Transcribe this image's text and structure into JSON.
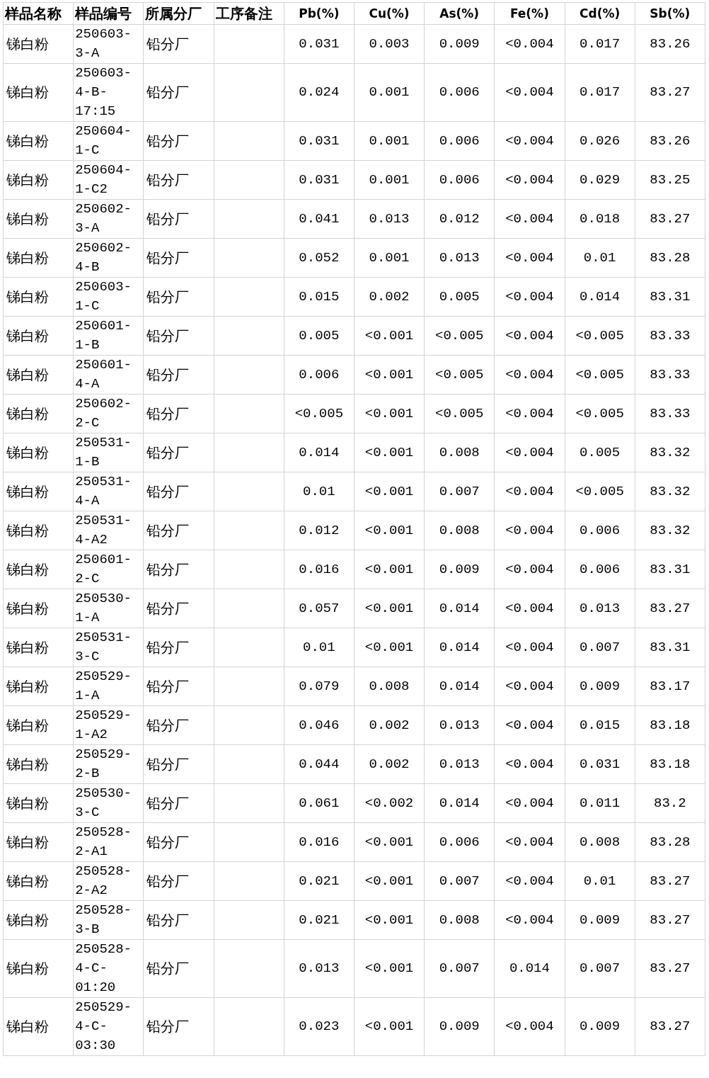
{
  "table": {
    "columns": [
      "样品名称",
      "样品编号",
      "所属分厂",
      "工序备注",
      "Pb(%)",
      "Cu(%)",
      "As(%)",
      "Fe(%)",
      "Cd(%)",
      "Sb(%)"
    ],
    "rows": [
      {
        "name": "锑白粉",
        "code": "250603-3-A",
        "factory": "铅分厂",
        "values": [
          "0.031",
          "0.003",
          "0.009",
          "<0.004",
          "0.017",
          "83.26"
        ]
      },
      {
        "name": "锑白粉",
        "code": "250603-4-B-17:15",
        "factory": "铅分厂",
        "values": [
          "0.024",
          "0.001",
          "0.006",
          "<0.004",
          "0.017",
          "83.27"
        ]
      },
      {
        "name": "锑白粉",
        "code": "250604-1-C",
        "factory": "铅分厂",
        "values": [
          "0.031",
          "0.001",
          "0.006",
          "<0.004",
          "0.026",
          "83.26"
        ]
      },
      {
        "name": "锑白粉",
        "code": "250604-1-C2",
        "factory": "铅分厂",
        "values": [
          "0.031",
          "0.001",
          "0.006",
          "<0.004",
          "0.029",
          "83.25"
        ]
      },
      {
        "name": "锑白粉",
        "code": "250602-3-A",
        "factory": "铅分厂",
        "values": [
          "0.041",
          "0.013",
          "0.012",
          "<0.004",
          "0.018",
          "83.27"
        ]
      },
      {
        "name": "锑白粉",
        "code": "250602-4-B",
        "factory": "铅分厂",
        "values": [
          "0.052",
          "0.001",
          "0.013",
          "<0.004",
          "0.01",
          "83.28"
        ]
      },
      {
        "name": "锑白粉",
        "code": "250603-1-C",
        "factory": "铅分厂",
        "values": [
          "0.015",
          "0.002",
          "0.005",
          "<0.004",
          "0.014",
          "83.31"
        ]
      },
      {
        "name": "锑白粉",
        "code": "250601-1-B",
        "factory": "铅分厂",
        "values": [
          "0.005",
          "<0.001",
          "<0.005",
          "<0.004",
          "<0.005",
          "83.33"
        ]
      },
      {
        "name": "锑白粉",
        "code": "250601-4-A",
        "factory": "铅分厂",
        "values": [
          "0.006",
          "<0.001",
          "<0.005",
          "<0.004",
          "<0.005",
          "83.33"
        ]
      },
      {
        "name": "锑白粉",
        "code": "250602-2-C",
        "factory": "铅分厂",
        "values": [
          "<0.005",
          "<0.001",
          "<0.005",
          "<0.004",
          "<0.005",
          "83.33"
        ]
      },
      {
        "name": "锑白粉",
        "code": "250531-1-B",
        "factory": "铅分厂",
        "values": [
          "0.014",
          "<0.001",
          "0.008",
          "<0.004",
          "0.005",
          "83.32"
        ]
      },
      {
        "name": "锑白粉",
        "code": "250531-4-A",
        "factory": "铅分厂",
        "values": [
          "0.01",
          "<0.001",
          "0.007",
          "<0.004",
          "<0.005",
          "83.32"
        ]
      },
      {
        "name": "锑白粉",
        "code": "250531-4-A2",
        "factory": "铅分厂",
        "values": [
          "0.012",
          "<0.001",
          "0.008",
          "<0.004",
          "0.006",
          "83.32"
        ]
      },
      {
        "name": "锑白粉",
        "code": "250601-2-C",
        "factory": "铅分厂",
        "values": [
          "0.016",
          "<0.001",
          "0.009",
          "<0.004",
          "0.006",
          "83.31"
        ]
      },
      {
        "name": "锑白粉",
        "code": "250530-1-A",
        "factory": "铅分厂",
        "values": [
          "0.057",
          "<0.001",
          "0.014",
          "<0.004",
          "0.013",
          "83.27"
        ]
      },
      {
        "name": "锑白粉",
        "code": "250531-3-C",
        "factory": "铅分厂",
        "values": [
          "0.01",
          "<0.001",
          "0.014",
          "<0.004",
          "0.007",
          "83.31"
        ]
      },
      {
        "name": "锑白粉",
        "code": "250529-1-A",
        "factory": "铅分厂",
        "values": [
          "0.079",
          "0.008",
          "0.014",
          "<0.004",
          "0.009",
          "83.17"
        ]
      },
      {
        "name": "锑白粉",
        "code": "250529-1-A2",
        "factory": "铅分厂",
        "values": [
          "0.046",
          "0.002",
          "0.013",
          "<0.004",
          "0.015",
          "83.18"
        ]
      },
      {
        "name": "锑白粉",
        "code": "250529-2-B",
        "factory": "铅分厂",
        "values": [
          "0.044",
          "0.002",
          "0.013",
          "<0.004",
          "0.031",
          "83.18"
        ]
      },
      {
        "name": "锑白粉",
        "code": "250530-3-C",
        "factory": "铅分厂",
        "values": [
          "0.061",
          "<0.002",
          "0.014",
          "<0.004",
          "0.011",
          "83.2"
        ]
      },
      {
        "name": "锑白粉",
        "code": "250528-2-A1",
        "factory": "铅分厂",
        "values": [
          "0.016",
          "<0.001",
          "0.006",
          "<0.004",
          "0.008",
          "83.28"
        ]
      },
      {
        "name": "锑白粉",
        "code": "250528-2-A2",
        "factory": "铅分厂",
        "values": [
          "0.021",
          "<0.001",
          "0.007",
          "<0.004",
          "0.01",
          "83.27"
        ]
      },
      {
        "name": "锑白粉",
        "code": "250528-3-B",
        "factory": "铅分厂",
        "values": [
          "0.021",
          "<0.001",
          "0.008",
          "<0.004",
          "0.009",
          "83.27"
        ]
      },
      {
        "name": "锑白粉",
        "code": "250528-4-C-01:20",
        "factory": "铅分厂",
        "values": [
          "0.013",
          "<0.001",
          "0.007",
          "0.014",
          "0.007",
          "83.27"
        ]
      },
      {
        "name": "锑白粉",
        "code": "250529-4-C-03:30",
        "factory": "铅分厂",
        "values": [
          "0.023",
          "<0.001",
          "0.009",
          "<0.004",
          "0.009",
          "83.27"
        ]
      }
    ]
  }
}
